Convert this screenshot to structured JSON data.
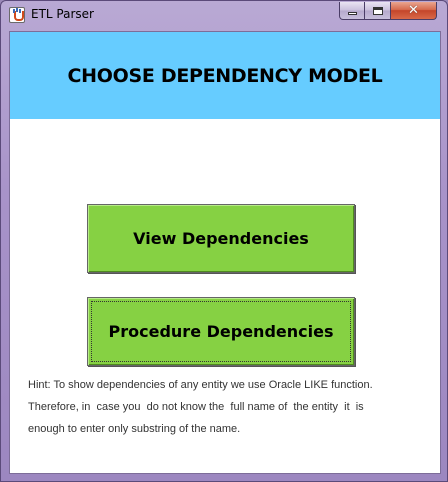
{
  "window": {
    "title": "ETL Parser",
    "controls": {
      "minimize": "minimize-icon",
      "maximize": "maximize-icon",
      "close": "close-icon"
    }
  },
  "header": {
    "title": "CHOOSE DEPENDENCY MODEL",
    "background": "#66ccff"
  },
  "buttons": {
    "view_label": "View Dependencies",
    "procedure_label": "Procedure Dependencies",
    "color": "#86d143"
  },
  "hint": {
    "line1": "Hint: To show dependencies of any entity we use Oracle LIKE function.",
    "line2": "Therefore, in  case you  do not know the  full name of  the entity  it  is",
    "line3": "enough to enter only substring of the name."
  }
}
